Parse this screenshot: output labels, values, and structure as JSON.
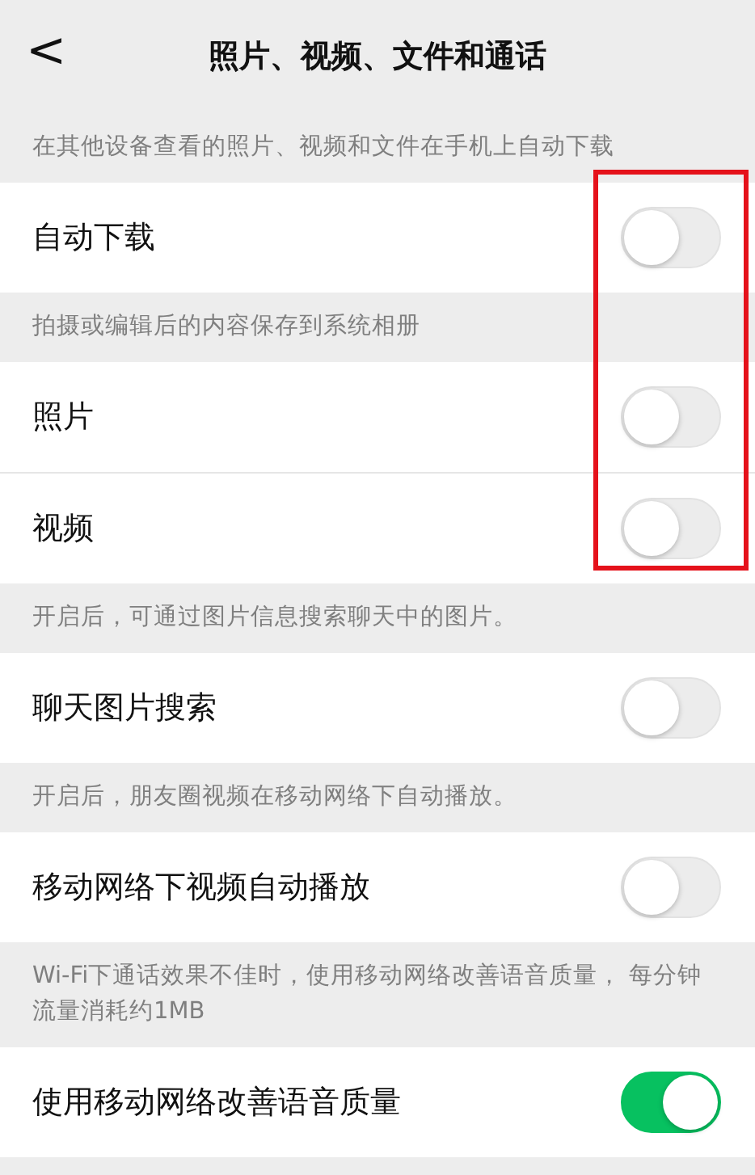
{
  "header": {
    "back": "<",
    "title": "照片、视频、文件和通话"
  },
  "groups": [
    {
      "note": "在其他设备查看的照片、视频和文件在手机上自动下载",
      "rows": [
        {
          "label": "自动下载",
          "on": false
        }
      ]
    },
    {
      "note": "拍摄或编辑后的内容保存到系统相册",
      "rows": [
        {
          "label": "照片",
          "on": false
        },
        {
          "label": "视频",
          "on": false
        }
      ]
    },
    {
      "note": "开启后，可通过图片信息搜索聊天中的图片。",
      "rows": [
        {
          "label": "聊天图片搜索",
          "on": false
        }
      ]
    },
    {
      "note": "开启后，朋友圈视频在移动网络下自动播放。",
      "rows": [
        {
          "label": "移动网络下视频自动播放",
          "on": false
        }
      ]
    },
    {
      "note": "Wi-Fi下通话效果不佳时，使用移动网络改善语音质量， 每分钟流量消耗约1MB",
      "rows": [
        {
          "label": "使用移动网络改善语音质量",
          "on": true
        }
      ]
    }
  ],
  "annotation_frame": {
    "color": "#e5121b"
  }
}
